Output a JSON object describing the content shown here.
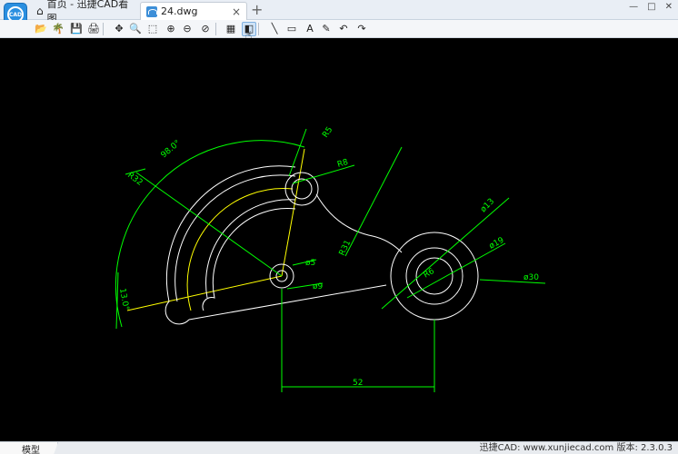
{
  "app": {
    "logo_text": "CAD",
    "home_tab_label": "首页 - 迅捷CAD看图",
    "file_tab_label": "24.dwg",
    "new_tab_symbol": "+",
    "close_symbol": "×"
  },
  "window_controls": {
    "minimize": "—",
    "maximize": "□",
    "close": "✕"
  },
  "toolbar": {
    "items": [
      {
        "icon": "open-icon",
        "glyph": "📂"
      },
      {
        "icon": "palm-icon",
        "glyph": "🌴"
      },
      {
        "icon": "save-icon",
        "glyph": "💾"
      },
      {
        "icon": "print-icon",
        "glyph": "🖨"
      },
      {
        "icon": "pan-icon",
        "glyph": "✥"
      },
      {
        "icon": "zoom-realtime-icon",
        "glyph": "🔍"
      },
      {
        "icon": "zoom-window-icon",
        "glyph": "⬚"
      },
      {
        "icon": "zoom-in-icon",
        "glyph": "⊕"
      },
      {
        "icon": "zoom-out-icon",
        "glyph": "⊖"
      },
      {
        "icon": "zoom-extents-icon",
        "glyph": "⊘"
      },
      {
        "icon": "layers-icon",
        "glyph": "▦"
      },
      {
        "icon": "view-3d-icon",
        "glyph": "◧"
      },
      {
        "icon": "measure-line-icon",
        "glyph": "╲"
      },
      {
        "icon": "rectangle-icon",
        "glyph": "▭"
      },
      {
        "icon": "text-icon",
        "glyph": "A"
      },
      {
        "icon": "eraser-icon",
        "glyph": "✎"
      },
      {
        "icon": "undo-icon",
        "glyph": "↶"
      },
      {
        "icon": "redo-icon",
        "glyph": "↷"
      }
    ]
  },
  "colors": {
    "canvas": "#000000",
    "geometry": "#ffffff",
    "centerline": "#ffff00",
    "dimension": "#00ff00"
  },
  "dimensions": {
    "angle_98": "98.0°",
    "r32": "R32",
    "r5": "R5",
    "r8": "R8",
    "r31": "R31",
    "d5": "ø5",
    "d9": "ø9",
    "d13": "ø13",
    "d19": "ø19",
    "d30": "ø30",
    "r6": "R6",
    "angle_13": "13.0°",
    "len_52": "52"
  },
  "statusbar": {
    "model_tab": "模型",
    "status": "迅捷CAD: www.xunjiecad.com 版本: 2.3.0.3"
  }
}
